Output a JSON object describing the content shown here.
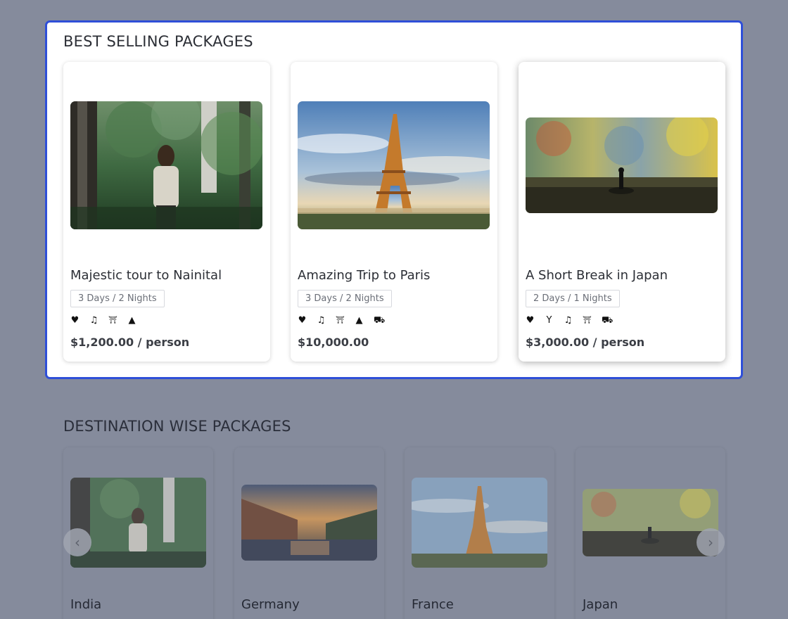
{
  "best_selling": {
    "title": "BEST SELLING PACKAGES",
    "cards": [
      {
        "title": "Majestic tour to Nainital",
        "duration": "3 Days / 2 Nights",
        "icons": [
          "heart-icon",
          "music-icon",
          "sightseeing-icon",
          "tree-icon"
        ],
        "price": "$1,200.00 / person"
      },
      {
        "title": "Amazing Trip to Paris",
        "duration": "3 Days / 2 Nights",
        "icons": [
          "heart-icon",
          "music-icon",
          "sightseeing-icon",
          "tree-icon",
          "shopping-icon"
        ],
        "price": "$10,000.00"
      },
      {
        "title": "A Short Break in Japan",
        "duration": "2 Days / 1 Nights",
        "icons": [
          "heart-icon",
          "cocktail-icon",
          "music-icon",
          "sightseeing-icon",
          "shopping-icon"
        ],
        "price": "$3,000.00 / person"
      }
    ]
  },
  "destination_wise": {
    "title": "DESTINATION WISE PACKAGES",
    "cards": [
      {
        "name": "India"
      },
      {
        "name": "Germany"
      },
      {
        "name": "France"
      },
      {
        "name": "Japan"
      }
    ],
    "prev_icon": "chevron-left-icon",
    "next_icon": "chevron-right-icon"
  },
  "colors": {
    "overlay": "#858b9c",
    "panel_border": "#2f4fd8"
  }
}
